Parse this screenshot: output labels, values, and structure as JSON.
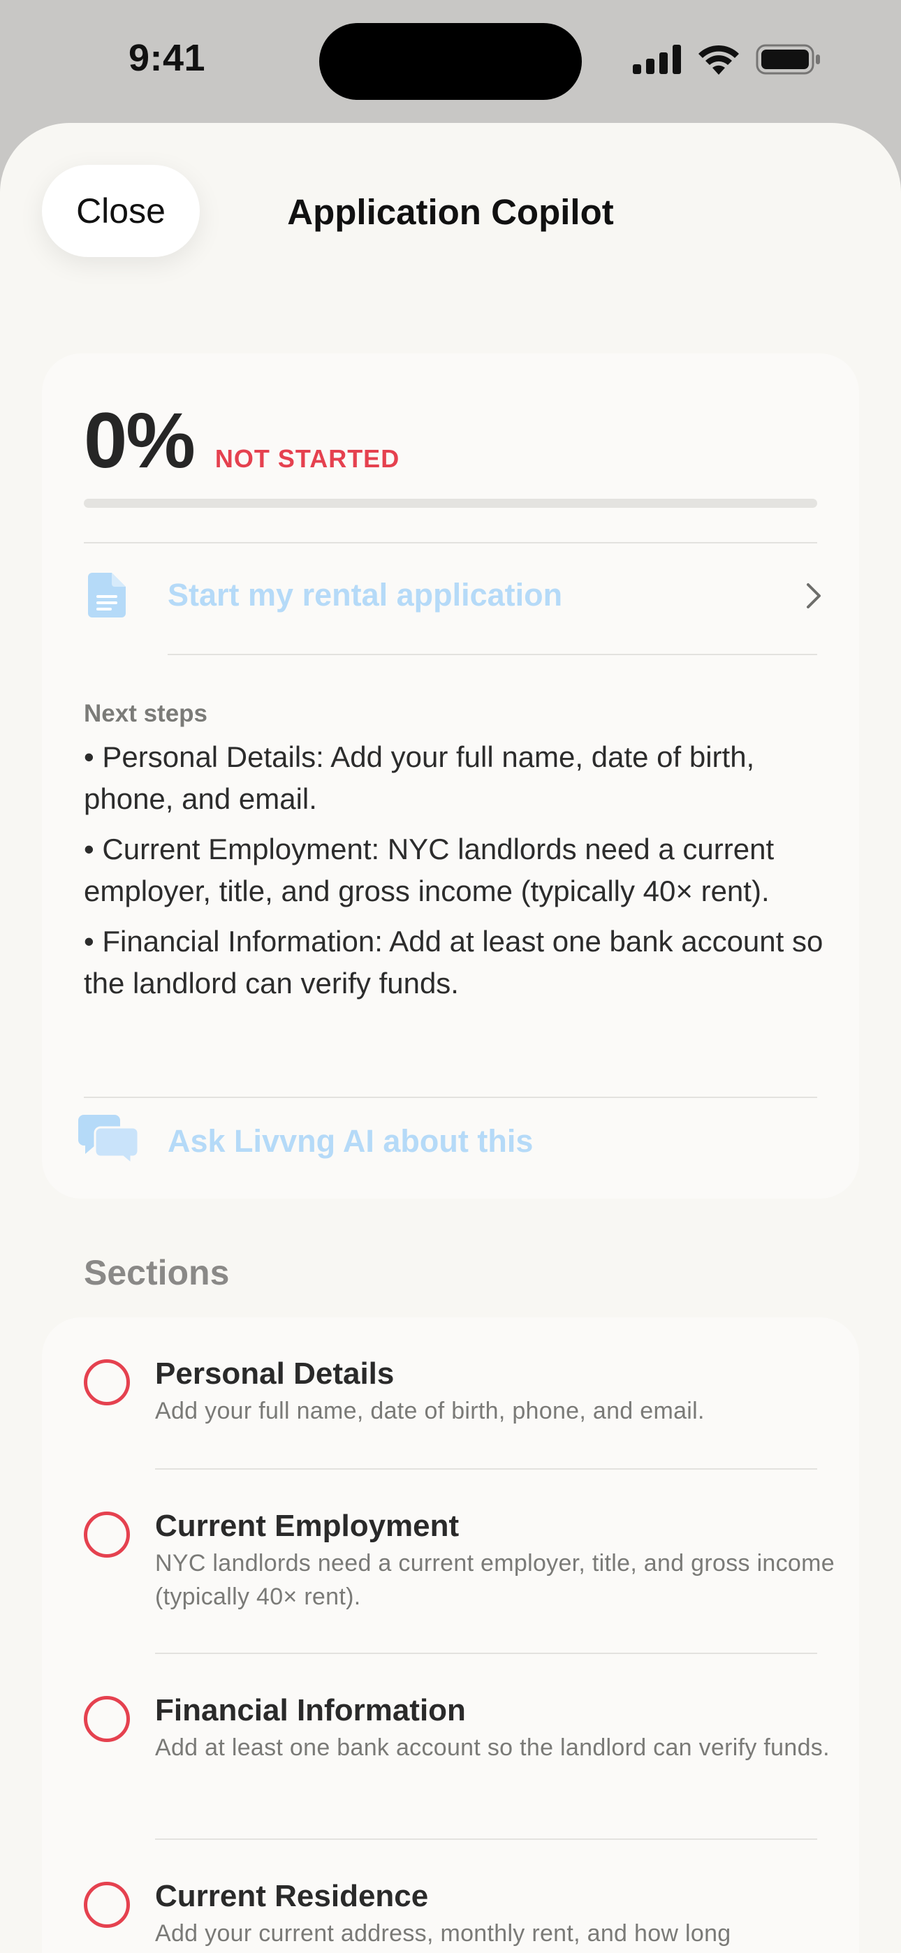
{
  "status_bar": {
    "time": "9:41",
    "icons": [
      "cellular-signal-icon",
      "wifi-icon",
      "battery-icon"
    ]
  },
  "header": {
    "close_label": "Close",
    "title": "Application Copilot"
  },
  "progress": {
    "percent_label": "0%",
    "percent_value": 0,
    "status": "NOT STARTED",
    "status_color": "#e5414f"
  },
  "start_action": {
    "icon": "document-icon",
    "label": "Start my rental application"
  },
  "next_steps": {
    "label": "Next steps",
    "items": [
      "• Personal Details: Add your full name, date of birth, phone, and email.",
      "• Current Employment: NYC landlords need a current employer, title, and gross income (typically 40× rent).",
      "• Financial Information: Add at least one bank account so the landlord can verify funds."
    ]
  },
  "ask_ai": {
    "icon": "chat-bubbles-icon",
    "label": "Ask Livvng AI about this"
  },
  "sections": {
    "heading": "Sections",
    "items": [
      {
        "title": "Personal Details",
        "description": "Add your full name, date of birth, phone, and email."
      },
      {
        "title": "Current Employment",
        "description": "NYC landlords need a current employer, title, and gross income (typically 40× rent)."
      },
      {
        "title": "Financial Information",
        "description": "Add at least one bank account so the landlord can verify funds."
      },
      {
        "title": "Current Residence",
        "description": "Add your current address, monthly rent, and how long"
      }
    ]
  },
  "colors": {
    "accent_light": "#b5daf8",
    "incomplete": "#e5414f",
    "sheet_background": "#f8f7f3"
  }
}
